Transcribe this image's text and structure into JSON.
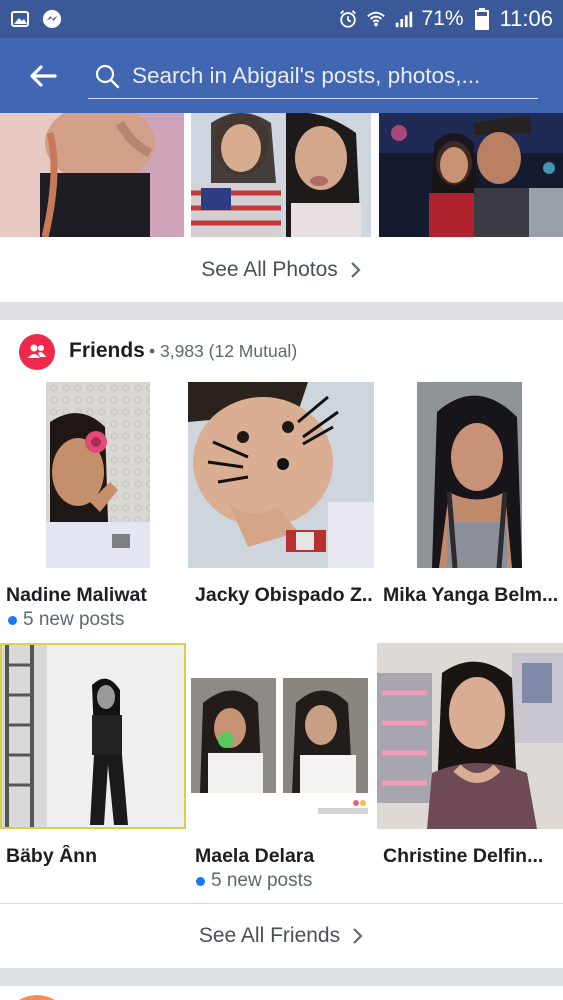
{
  "status_bar": {
    "battery_percent": "71%",
    "time": "11:06",
    "icons": [
      "gallery-icon",
      "messenger-icon",
      "alarm-icon",
      "wifi-icon",
      "signal-icon",
      "battery-icon"
    ]
  },
  "app_bar": {
    "back_icon": "back-arrow-icon",
    "search_placeholder": "Search in Abigail's posts, photos,..."
  },
  "photos": {
    "see_all_label": "See All Photos",
    "thumb_count": 3
  },
  "friends": {
    "title": "Friends",
    "count_text": "• 3,983 (12 Mutual)",
    "items": [
      {
        "name": "Nadine Maliwat",
        "sub": "5 new posts",
        "has_sub": true
      },
      {
        "name": "Jacky Obispado Z...",
        "sub": "",
        "has_sub": false
      },
      {
        "name": "Mika Yanga Belm...",
        "sub": "",
        "has_sub": false
      },
      {
        "name": "Bäby Ânn",
        "sub": "",
        "has_sub": false
      },
      {
        "name": "Maela Delara",
        "sub": "5 new posts",
        "has_sub": true
      },
      {
        "name": "Christine Delfin...",
        "sub": "",
        "has_sub": false
      }
    ],
    "see_all_label": "See All Friends"
  },
  "colors": {
    "status_bar": "#3b5998",
    "app_bar": "#4267b2",
    "friends_badge": "#f02849",
    "new_post_dot": "#1877f2"
  }
}
